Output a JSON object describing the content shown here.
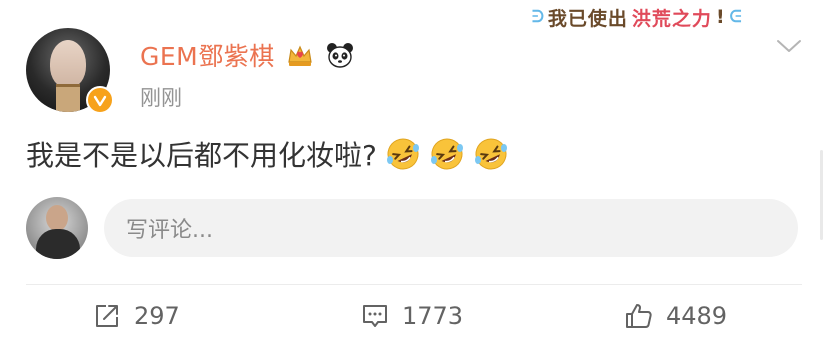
{
  "post": {
    "author": {
      "name": "GEM鄧紫棋",
      "avatar_icon": "user-avatar",
      "verified_icon": "verified-v-badge",
      "badges": [
        "crown-badge-icon",
        "panda-icon"
      ]
    },
    "timestamp": "刚刚",
    "sticker": {
      "text_main": "我已使出",
      "text_highlight": "洪荒之力",
      "text_end": "!"
    },
    "content": "我是不是以后都不用化妆啦?",
    "emojis": [
      "rolling-laugh-emoji",
      "rolling-laugh-emoji",
      "rolling-laugh-emoji"
    ]
  },
  "comment_box": {
    "placeholder": "写评论..."
  },
  "actions": {
    "repost_count": "297",
    "comment_count": "1773",
    "like_count": "4489"
  },
  "colors": {
    "username": "#eb7350",
    "timestamp": "#939393",
    "verified": "#f7a21b",
    "action_text": "#636363"
  }
}
